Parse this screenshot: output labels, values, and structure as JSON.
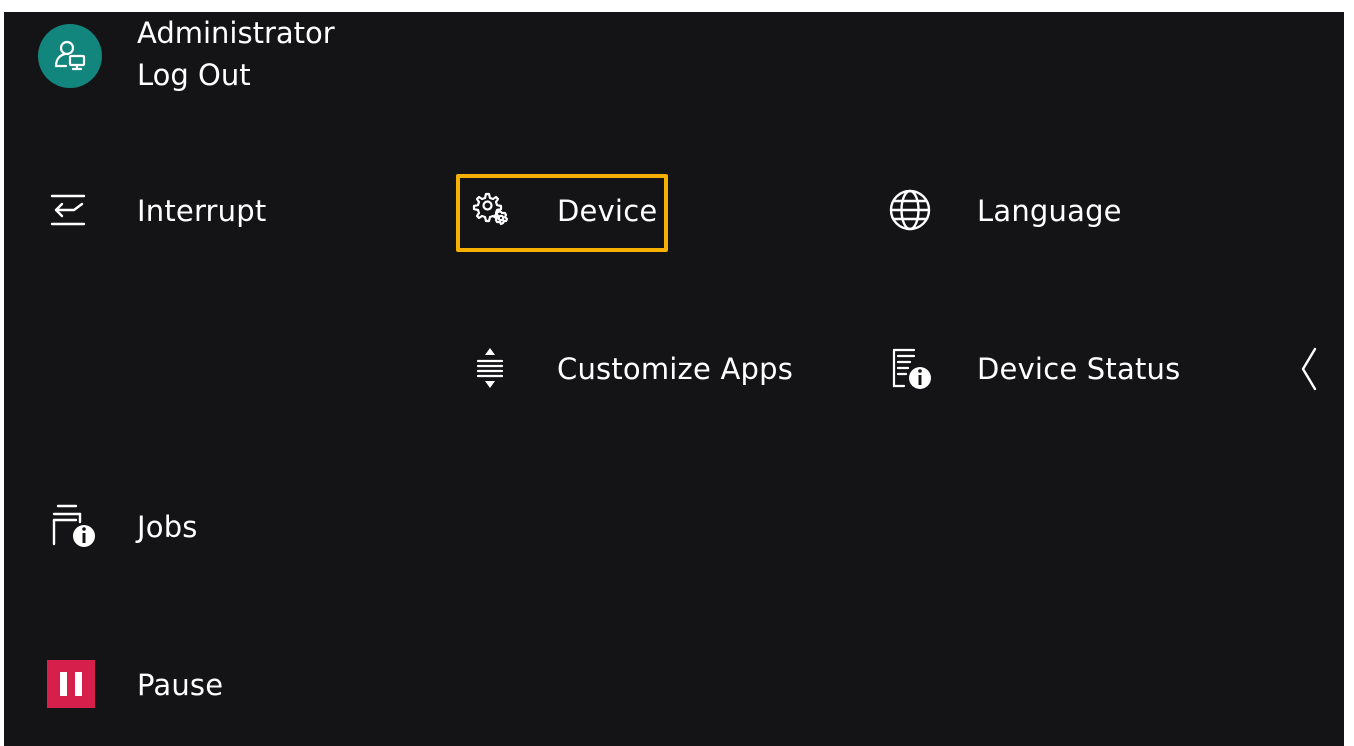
{
  "user": {
    "name": "Administrator",
    "logout_label": "Log Out",
    "avatar_icon": "user-admin-icon",
    "avatar_color": "#12857c"
  },
  "menu": {
    "interrupt": {
      "label": "Interrupt",
      "icon": "interrupt-icon"
    },
    "device": {
      "label": "Device",
      "icon": "gear-icon",
      "selected": true
    },
    "language": {
      "label": "Language",
      "icon": "globe-icon"
    },
    "customize_apps": {
      "label": "Customize Apps",
      "icon": "reorder-icon"
    },
    "device_status": {
      "label": "Device Status",
      "icon": "device-info-icon"
    },
    "jobs": {
      "label": "Jobs",
      "icon": "jobs-info-icon"
    },
    "pause": {
      "label": "Pause",
      "icon": "pause-icon",
      "color": "#d61f4b"
    }
  },
  "collapse_icon": "chevron-left-icon",
  "colors": {
    "background": "#141417",
    "focus": "#f5b000",
    "text": "#ffffff"
  }
}
